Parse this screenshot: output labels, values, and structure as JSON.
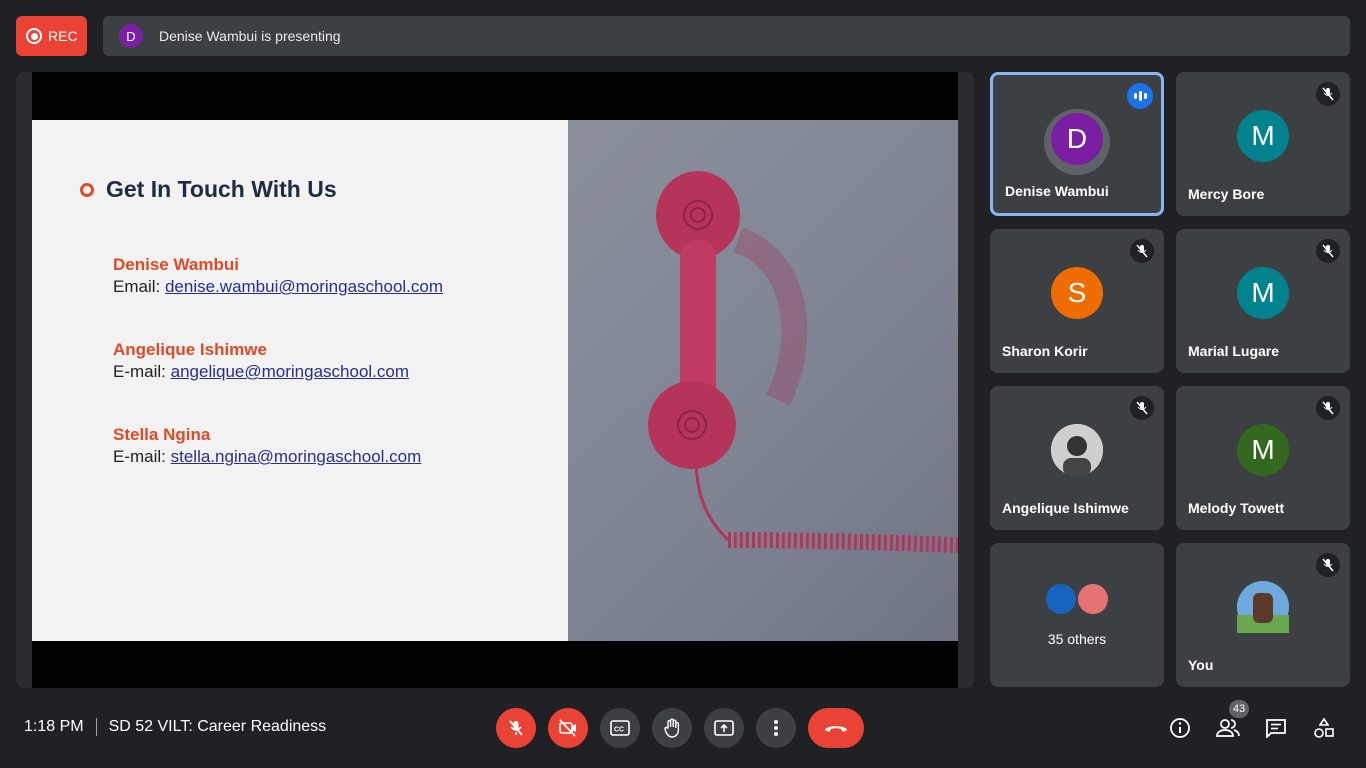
{
  "rec": {
    "label": "REC"
  },
  "banner": {
    "avatar_letter": "D",
    "text": "Denise Wambui is presenting"
  },
  "slide": {
    "heading": "Get In Touch With Us",
    "contacts": [
      {
        "name": "Denise Wambui",
        "label": "Email: ",
        "email": "denise.wambui@moringaschool.com"
      },
      {
        "name": "Angelique Ishimwe",
        "label": "E-mail: ",
        "email": "angelique@moringaschool.com"
      },
      {
        "name": "Stella Ngina",
        "label": "E-mail: ",
        "email": "stella.ngina@moringaschool.com"
      }
    ]
  },
  "participants": [
    {
      "name": "Denise Wambui",
      "letter": "D",
      "color": "#7b1fa2",
      "speaking": true
    },
    {
      "name": "Mercy Bore",
      "letter": "M",
      "color": "#00838f",
      "muted": true
    },
    {
      "name": "Sharon Korir",
      "letter": "S",
      "color": "#ef6c00",
      "muted": true
    },
    {
      "name": "Marial Lugare",
      "letter": "M",
      "color": "#00838f",
      "muted": true
    },
    {
      "name": "Angelique Ishimwe",
      "letter": "",
      "color": "#5f6368",
      "muted": true
    },
    {
      "name": "Melody Towett",
      "letter": "M",
      "color": "#33691e",
      "muted": true
    },
    {
      "name": "",
      "others_label": "35 others"
    },
    {
      "name": "You",
      "muted": true
    }
  ],
  "footer": {
    "time": "1:18 PM",
    "meeting_title": "SD 52 VILT: Career Readiness",
    "people_count": "43"
  },
  "icons": {
    "mic": "mic-off-icon",
    "cam": "camera-off-icon",
    "cc": "captions-icon",
    "hand": "raise-hand-icon",
    "present": "present-screen-icon",
    "more": "more-options-icon",
    "leave": "leave-call-icon",
    "info": "info-icon",
    "people": "people-icon",
    "chat": "chat-icon",
    "activities": "activities-icon"
  }
}
